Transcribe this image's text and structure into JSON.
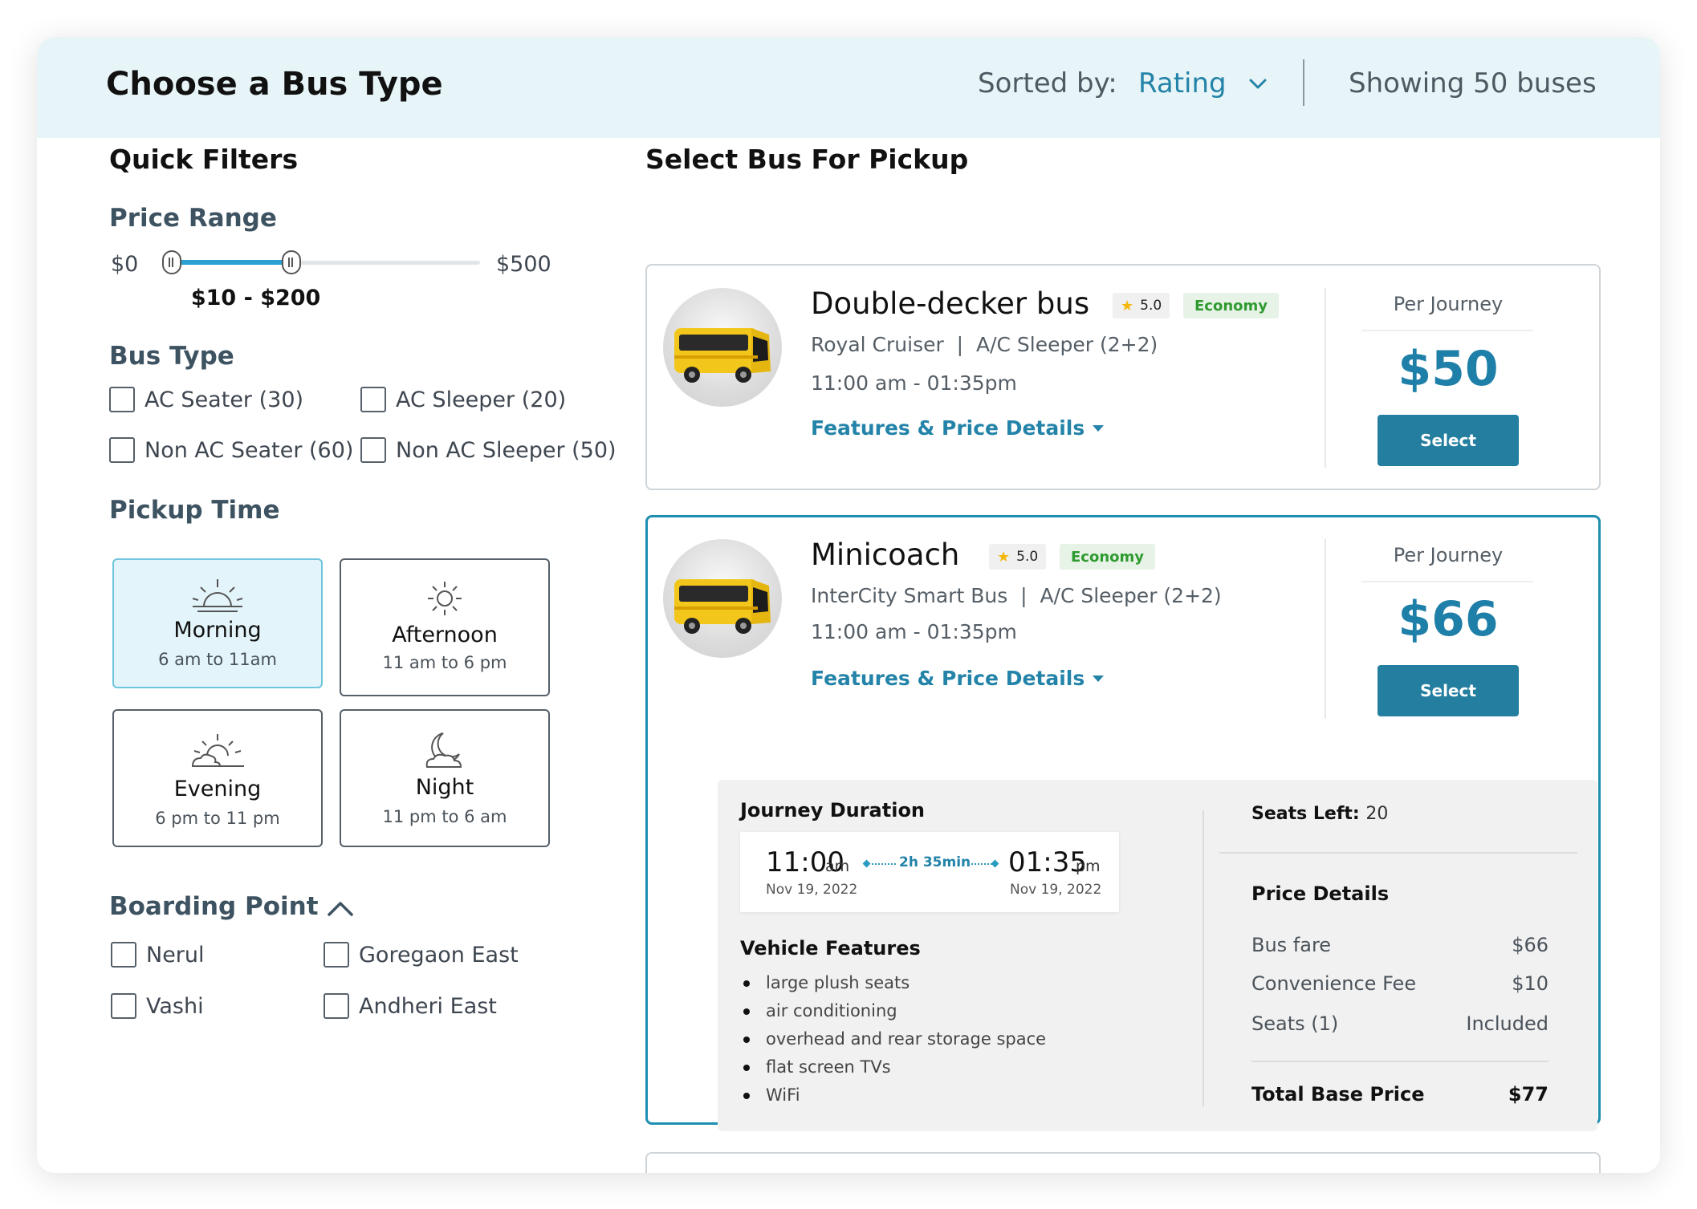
{
  "header": {
    "title": "Choose a Bus Type",
    "sorted_label": "Sorted by:",
    "sorted_value": "Rating",
    "showing": "Showing 50 buses"
  },
  "filters": {
    "title": "Quick Filters",
    "price": {
      "label": "Price Range",
      "min": "$0",
      "max": "$500",
      "selected": "$10 - $200",
      "low_fraction": 0.02,
      "high_fraction": 0.4
    },
    "bus_type": {
      "label": "Bus Type",
      "options": [
        {
          "label": "AC Seater (30)",
          "checked": false
        },
        {
          "label": "AC Sleeper (20)",
          "checked": false
        },
        {
          "label": "Non AC Seater (60)",
          "checked": false
        },
        {
          "label": "Non AC Sleeper (50)",
          "checked": false
        }
      ]
    },
    "pickup_time": {
      "label": "Pickup Time",
      "slots": [
        {
          "name": "Morning",
          "range": "6 am to 11am",
          "active": true,
          "icon": "sunrise-icon"
        },
        {
          "name": "Afternoon",
          "range": "11 am to 6 pm",
          "active": false,
          "icon": "sun-icon"
        },
        {
          "name": "Evening",
          "range": "6 pm to 11 pm",
          "active": false,
          "icon": "sunset-cloud-icon"
        },
        {
          "name": "Night",
          "range": "11 pm to 6 am",
          "active": false,
          "icon": "moon-cloud-icon"
        }
      ]
    },
    "boarding_point": {
      "label": "Boarding Point",
      "options": [
        {
          "label": "Nerul",
          "checked": false
        },
        {
          "label": "Goregaon East",
          "checked": false
        },
        {
          "label": "Vashi",
          "checked": false
        },
        {
          "label": "Andheri East",
          "checked": false
        }
      ]
    }
  },
  "results": {
    "title": "Select Bus For Pickup",
    "buses": [
      {
        "name": "Double-decker bus",
        "rating": "5.0",
        "class": "Economy",
        "operator": "Royal Cruiser",
        "type": "A/C Sleeper (2+2)",
        "time": "11:00 am - 01:35pm",
        "features_link": "Features & Price Details",
        "per_journey": "Per Journey",
        "price": "$50",
        "select": "Select"
      },
      {
        "name": "Minicoach",
        "rating": "5.0",
        "class": "Economy",
        "operator": "InterCity Smart Bus",
        "type": "A/C Sleeper (2+2)",
        "time": "11:00 am - 01:35pm",
        "features_link": "Features & Price Details",
        "per_journey": "Per Journey",
        "price": "$66",
        "select": "Select"
      }
    ],
    "details": {
      "journey_duration_label": "Journey Duration",
      "depart_time": "11:00",
      "depart_ampm": "am",
      "depart_date": "Nov 19, 2022",
      "duration": "2h 35min",
      "arrive_time": "01:35",
      "arrive_ampm": "pm",
      "arrive_date": "Nov 19, 2022",
      "vehicle_features_label": "Vehicle Features",
      "features": [
        "large plush seats",
        "air conditioning",
        "overhead and rear storage space",
        "flat screen TVs",
        "WiFi"
      ],
      "seats_left_label": "Seats Left:",
      "seats_left_value": "20",
      "price_details_label": "Price Details",
      "price_rows": [
        {
          "label": "Bus fare",
          "value": "$66"
        },
        {
          "label": "Convenience Fee",
          "value": "$10"
        },
        {
          "label": "Seats (1)",
          "value": "Included"
        }
      ],
      "total_label": "Total Base Price",
      "total_value": "$77"
    }
  },
  "colors": {
    "accent": "#2383a8",
    "header_bg": "#e8f5f8",
    "button": "#237e9f",
    "economy_text": "#2f9a2f",
    "star": "#f5b70a"
  }
}
